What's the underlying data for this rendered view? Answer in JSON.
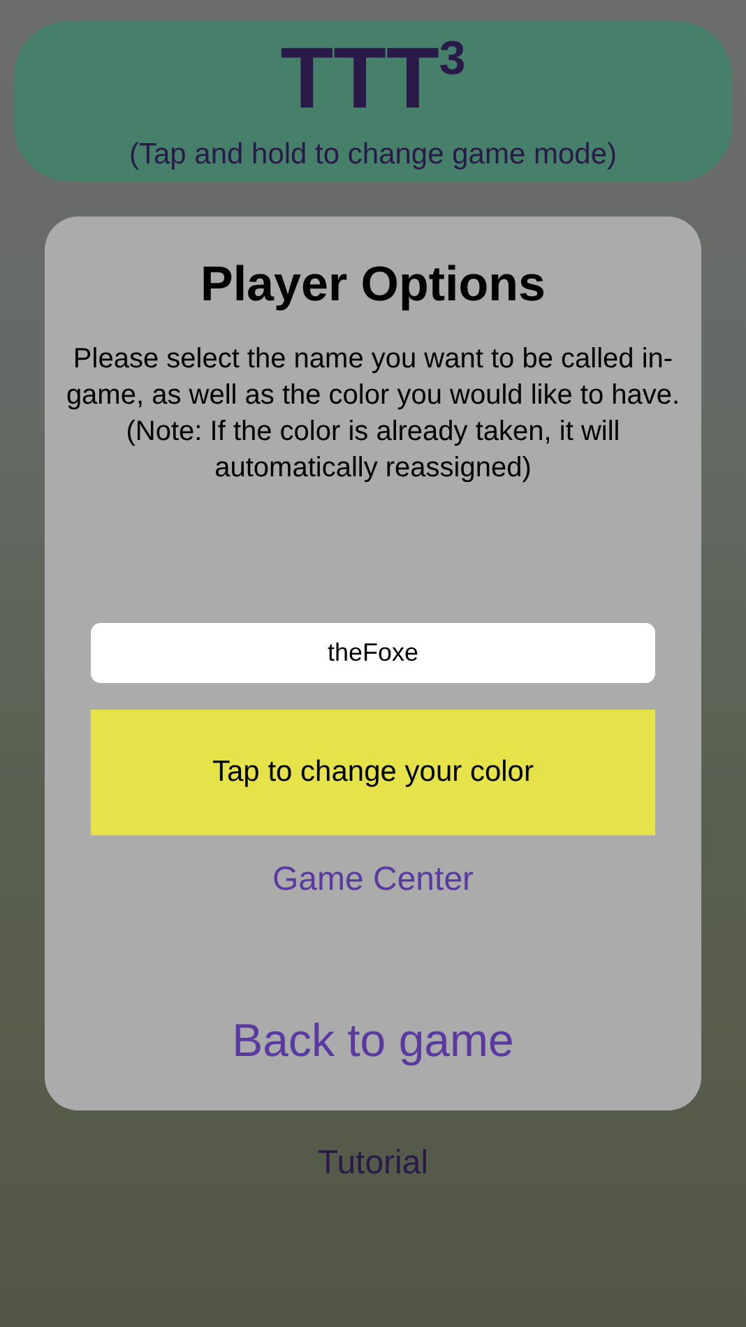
{
  "header": {
    "title": "TTT$^{3}$",
    "subtitle": "(Tap and hold to change game mode)"
  },
  "dialog": {
    "title": "Player Options",
    "message": "Please select the name you want to be called in-game, as well as the color you would like to have. (Note: If the color is already taken, it will automatically reassigned)",
    "name_field": {
      "value": "theFoxe"
    },
    "color_button": {
      "label": "Tap to change your color",
      "color": "#e5e24a"
    },
    "links": [
      "Game Center"
    ],
    "back_button": "Back to game"
  },
  "footer_link": "Tutorial"
}
